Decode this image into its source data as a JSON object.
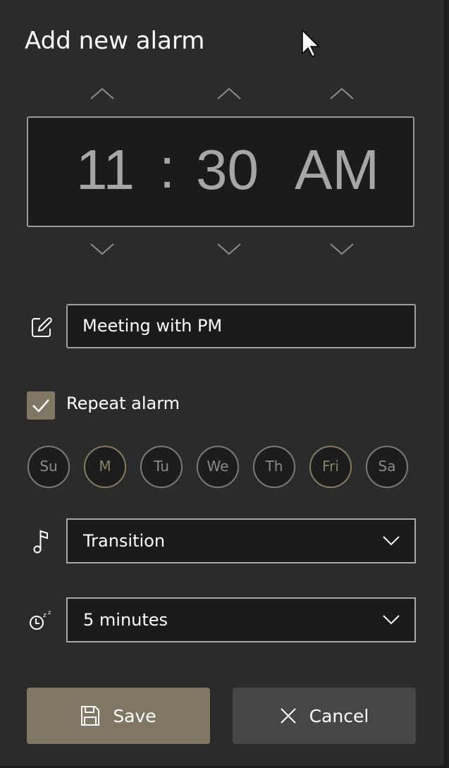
{
  "dialog": {
    "title": "Add new alarm"
  },
  "time": {
    "hour": "11",
    "separator": ":",
    "minute": "30",
    "period": "AM"
  },
  "alarm_name": {
    "value": "Meeting with PM",
    "icon": "edit-icon"
  },
  "repeat": {
    "label": "Repeat alarm",
    "checked": true
  },
  "days": [
    {
      "label": "Su",
      "selected": false
    },
    {
      "label": "M",
      "selected": true
    },
    {
      "label": "Tu",
      "selected": false
    },
    {
      "label": "We",
      "selected": false
    },
    {
      "label": "Th",
      "selected": false
    },
    {
      "label": "Fri",
      "selected": true
    },
    {
      "label": "Sa",
      "selected": false
    }
  ],
  "sound": {
    "value": "Transition",
    "icon": "music-note-icon"
  },
  "snooze": {
    "value": "5 minutes",
    "icon": "snooze-icon"
  },
  "buttons": {
    "save": "Save",
    "cancel": "Cancel"
  },
  "colors": {
    "accent": "#7f7664",
    "background": "#2b2b2b",
    "cancel": "#464646"
  }
}
